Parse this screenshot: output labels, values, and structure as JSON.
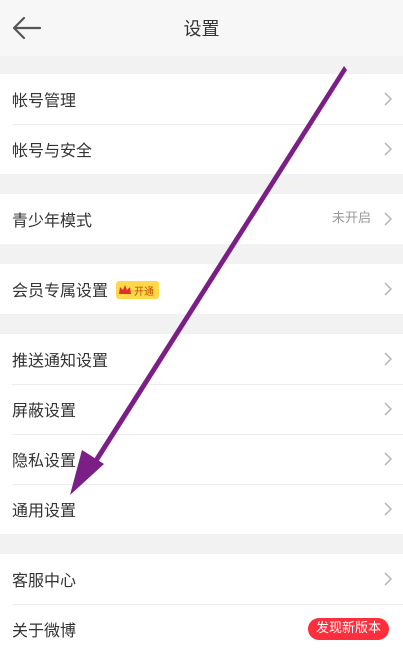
{
  "header": {
    "title": "设置"
  },
  "groups": [
    {
      "items": [
        {
          "label": "帐号管理"
        },
        {
          "label": "帐号与安全"
        }
      ]
    },
    {
      "items": [
        {
          "label": "青少年模式",
          "value": "未开启"
        }
      ]
    },
    {
      "items": [
        {
          "label": "会员专属设置",
          "badge": "开通"
        }
      ]
    },
    {
      "items": [
        {
          "label": "推送通知设置"
        },
        {
          "label": "屏蔽设置"
        },
        {
          "label": "隐私设置"
        },
        {
          "label": "通用设置"
        }
      ]
    },
    {
      "items": [
        {
          "label": "客服中心"
        },
        {
          "label": "关于微博",
          "badge": "发现新版本"
        }
      ]
    }
  ],
  "colors": {
    "annotation_arrow": "#7b1e86",
    "new_badge": "#ff2e3c",
    "vip_badge": "#ffd94a"
  }
}
